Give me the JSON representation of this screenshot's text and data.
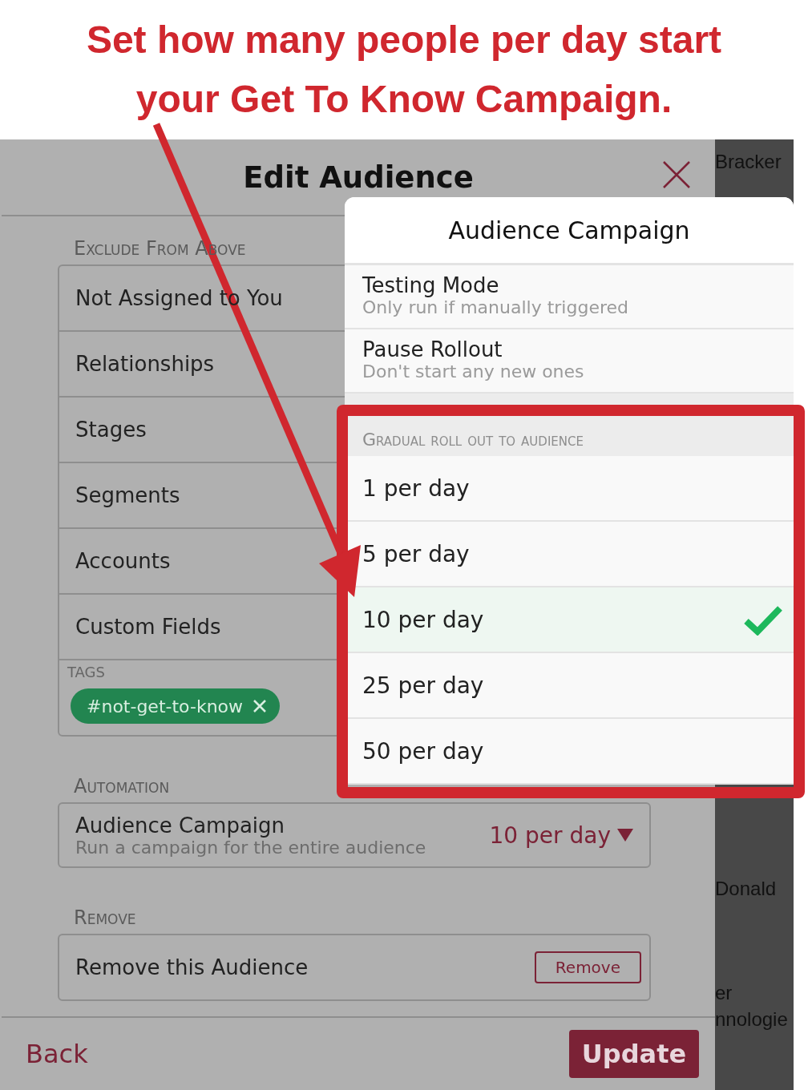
{
  "annotation": {
    "caption": "Set how many people per day start your Get To Know Campaign."
  },
  "background": {
    "names": [
      "Bracker",
      "Donald",
      "er",
      "nnologie"
    ]
  },
  "modal": {
    "title": "Edit Audience",
    "exclude": {
      "heading": "Exclude From Above",
      "items": [
        "Not Assigned to You",
        "Relationships",
        "Stages",
        "Segments",
        "Accounts",
        "Custom Fields"
      ],
      "tags_label": "TAGS",
      "tags": [
        "#not-get-to-know"
      ]
    },
    "automation": {
      "heading": "Automation",
      "title": "Audience Campaign",
      "subtitle": "Run a campaign for the entire audience",
      "value": "10 per day"
    },
    "remove": {
      "heading": "Remove",
      "label": "Remove this Audience",
      "button": "Remove"
    },
    "back": "Back",
    "update": "Update"
  },
  "popover": {
    "title": "Audience Campaign",
    "items": [
      {
        "title": "Testing Mode",
        "subtitle": "Only run if manually triggered"
      },
      {
        "title": "Pause Rollout",
        "subtitle": "Don't start any new ones"
      }
    ],
    "section": "Gradual roll out to audience",
    "options": [
      {
        "label": "1 per day",
        "selected": false
      },
      {
        "label": "5 per day",
        "selected": false
      },
      {
        "label": "10 per day",
        "selected": true
      },
      {
        "label": "25 per day",
        "selected": false
      },
      {
        "label": "50 per day",
        "selected": false
      }
    ]
  }
}
